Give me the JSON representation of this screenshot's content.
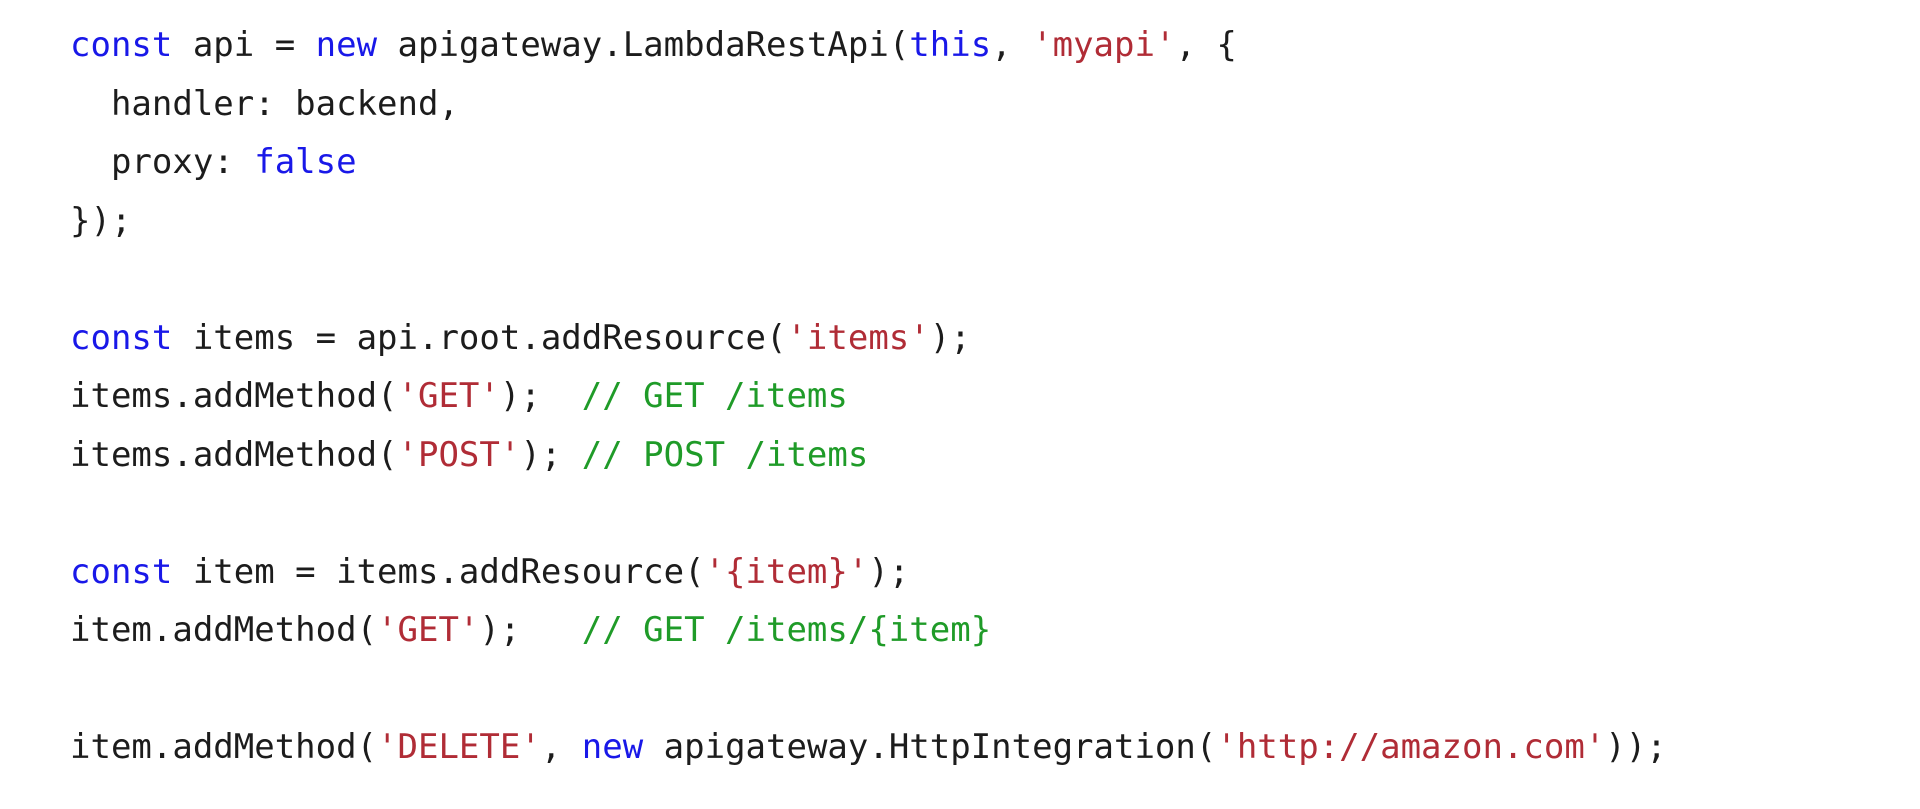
{
  "editor": {
    "language": "typescript",
    "background_color": "#ffffff",
    "colors": {
      "plain": "#1c1c1c",
      "keyword": "#1918e8",
      "string": "#b02c36",
      "comment": "#1f9b28"
    }
  },
  "code": {
    "lines": [
      {
        "id": "line-1",
        "tokens": [
          {
            "t": "const",
            "k": "keyword"
          },
          {
            "t": " api = ",
            "k": "plain"
          },
          {
            "t": "new",
            "k": "keyword"
          },
          {
            "t": " apigateway.LambdaRestApi(",
            "k": "plain"
          },
          {
            "t": "this",
            "k": "keyword"
          },
          {
            "t": ", ",
            "k": "plain"
          },
          {
            "t": "'myapi'",
            "k": "string"
          },
          {
            "t": ", {",
            "k": "plain"
          }
        ]
      },
      {
        "id": "line-2",
        "tokens": [
          {
            "t": "  handler: backend,",
            "k": "plain"
          }
        ]
      },
      {
        "id": "line-3",
        "tokens": [
          {
            "t": "  proxy: ",
            "k": "plain"
          },
          {
            "t": "false",
            "k": "keyword"
          }
        ]
      },
      {
        "id": "line-4",
        "tokens": [
          {
            "t": "});",
            "k": "plain"
          }
        ]
      },
      {
        "id": "line-5",
        "tokens": [
          {
            "t": " ",
            "k": "plain"
          }
        ]
      },
      {
        "id": "line-6",
        "tokens": [
          {
            "t": "const",
            "k": "keyword"
          },
          {
            "t": " items = api.root.addResource(",
            "k": "plain"
          },
          {
            "t": "'items'",
            "k": "string"
          },
          {
            "t": ");",
            "k": "plain"
          }
        ]
      },
      {
        "id": "line-7",
        "tokens": [
          {
            "t": "items.addMethod(",
            "k": "plain"
          },
          {
            "t": "'GET'",
            "k": "string"
          },
          {
            "t": ");  ",
            "k": "plain"
          },
          {
            "t": "// GET /items",
            "k": "comment"
          }
        ]
      },
      {
        "id": "line-8",
        "tokens": [
          {
            "t": "items.addMethod(",
            "k": "plain"
          },
          {
            "t": "'POST'",
            "k": "string"
          },
          {
            "t": "); ",
            "k": "plain"
          },
          {
            "t": "// POST /items",
            "k": "comment"
          }
        ]
      },
      {
        "id": "line-9",
        "tokens": [
          {
            "t": " ",
            "k": "plain"
          }
        ]
      },
      {
        "id": "line-10",
        "tokens": [
          {
            "t": "const",
            "k": "keyword"
          },
          {
            "t": " item = items.addResource(",
            "k": "plain"
          },
          {
            "t": "'{item}'",
            "k": "string"
          },
          {
            "t": ");",
            "k": "plain"
          }
        ]
      },
      {
        "id": "line-11",
        "tokens": [
          {
            "t": "item.addMethod(",
            "k": "plain"
          },
          {
            "t": "'GET'",
            "k": "string"
          },
          {
            "t": ");   ",
            "k": "plain"
          },
          {
            "t": "// GET /items/{item}",
            "k": "comment"
          }
        ]
      },
      {
        "id": "line-12",
        "tokens": [
          {
            "t": " ",
            "k": "plain"
          }
        ]
      },
      {
        "id": "line-13",
        "tokens": [
          {
            "t": "item.addMethod(",
            "k": "plain"
          },
          {
            "t": "'DELETE'",
            "k": "string"
          },
          {
            "t": ", ",
            "k": "plain"
          },
          {
            "t": "new",
            "k": "keyword"
          },
          {
            "t": " apigateway.HttpIntegration(",
            "k": "plain"
          },
          {
            "t": "'http://amazon.com'",
            "k": "string"
          },
          {
            "t": "));",
            "k": "plain"
          }
        ]
      }
    ]
  }
}
